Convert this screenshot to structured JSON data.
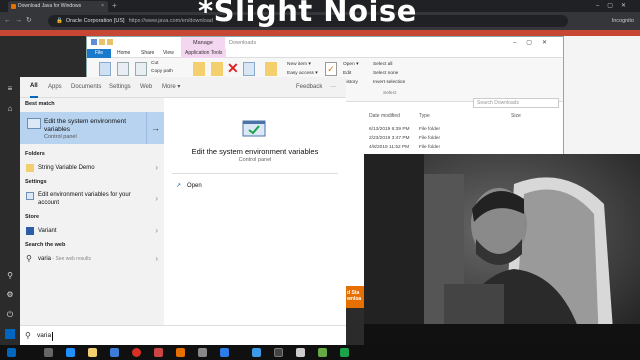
{
  "browser": {
    "tab_title": "Download Java for Windows",
    "tab_close": "×",
    "new_tab": "+",
    "window_controls": "–▢✕",
    "site_label": "Oracle Corporation [US]",
    "url": "https://www.java.com/en/download",
    "profile_label": "Incognito"
  },
  "explorer": {
    "manage_tab": "Manage",
    "window_title": "Downloads",
    "file_tab": "File",
    "tabs": [
      "Home",
      "Share",
      "View",
      "Application Tools"
    ],
    "ribbon": {
      "cut": "Cut",
      "copy_path": "Copy path",
      "new_item": "New item ▾",
      "easy_access": "Easy access ▾",
      "open": "Open ▾",
      "edit": "Edit",
      "history": "History",
      "select_all": "Select all",
      "select_none": "Select none",
      "invert_selection": "Invert selection",
      "select_group": "Select"
    },
    "search_placeholder": "Search Downloads",
    "headers": [
      "Date modified",
      "Type",
      "Size"
    ],
    "rows": [
      {
        "date": "6/13/2019 6:39 PM",
        "type": "File folder"
      },
      {
        "date": "2/23/2019 3:47 PM",
        "type": "File folder"
      },
      {
        "date": "4/8/2019 11:52 PM",
        "type": "File folder"
      }
    ]
  },
  "page_button": {
    "line1": "d Sta",
    "line2": "wnloa"
  },
  "start": {
    "tabs": [
      "All",
      "Apps",
      "Documents",
      "Settings",
      "Web",
      "More ▾"
    ],
    "feedback": "Feedback",
    "more_dots": "···",
    "best_match_header": "Best match",
    "best_match": {
      "line1": "Edit the system environment",
      "line2": "variables",
      "sub": "Control panel"
    },
    "folders_header": "Folders",
    "folders": [
      {
        "label": "String Variable Demo"
      }
    ],
    "settings_header": "Settings",
    "settings": [
      {
        "line1": "Edit environment variables for your",
        "line2": "account"
      }
    ],
    "store_header": "Store",
    "store": [
      {
        "label": "Variant"
      }
    ],
    "web_header": "Search the web",
    "web": {
      "query": "varia",
      "suffix": " - See web results"
    },
    "preview": {
      "title": "Edit the system environment variables",
      "sub": "Control panel",
      "open": "Open"
    },
    "search_text": "varia"
  },
  "watermark": "*Slight Noise",
  "colors": {
    "accent": "#0067c0",
    "highlight": "#b7d3ef",
    "oracle_red": "#c74634",
    "java_orange": "#e76f00",
    "file_blue": "#1979ca"
  }
}
